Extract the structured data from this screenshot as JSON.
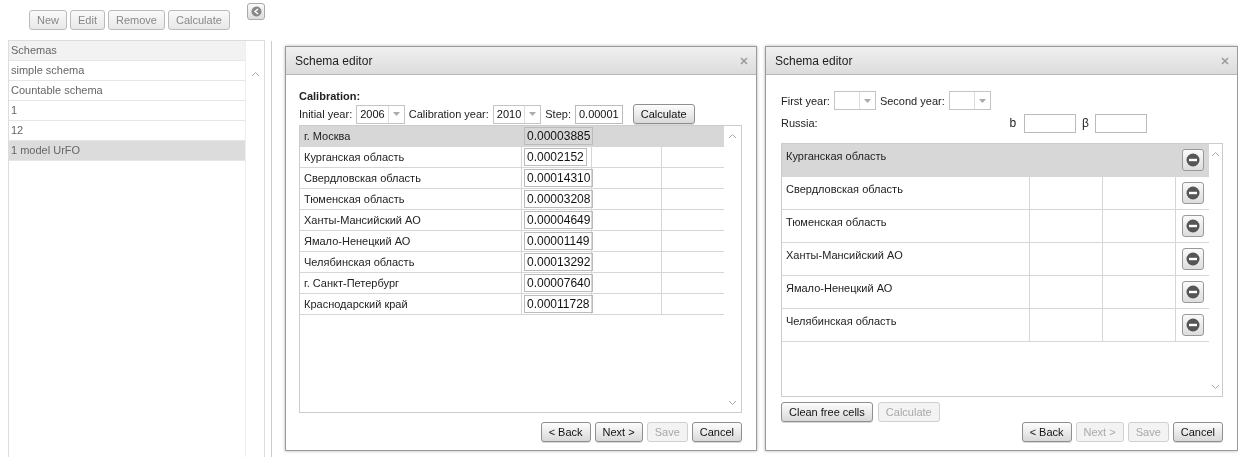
{
  "toolbar": {
    "buttons": [
      {
        "label": "New",
        "disabled": true
      },
      {
        "label": "Edit",
        "disabled": true
      },
      {
        "label": "Remove",
        "disabled": true
      },
      {
        "label": "Calculate",
        "disabled": true
      }
    ]
  },
  "schemas": {
    "header": "Schemas",
    "items": [
      {
        "label": "simple schema",
        "selected": false
      },
      {
        "label": "Countable schema",
        "selected": false
      },
      {
        "label": "1",
        "selected": false
      },
      {
        "label": "12",
        "selected": false
      },
      {
        "label": "1 model UrFO",
        "selected": true
      }
    ]
  },
  "calibration_dialog": {
    "title": "Schema editor",
    "section_title": "Calibration:",
    "initial_year": {
      "label": "Initial year:",
      "value": "2006"
    },
    "calibration_year": {
      "label": "Calibration year:",
      "value": "2010"
    },
    "step": {
      "label": "Step:",
      "value": "0.00001"
    },
    "calculate_button": "Calculate",
    "rows": [
      {
        "region": "г. Москва",
        "value": "0.00003885",
        "selected": true
      },
      {
        "region": "Курганская область",
        "value": "0.0002152",
        "selected": false
      },
      {
        "region": "Свердловская область",
        "value": "0.00014310",
        "selected": false
      },
      {
        "region": "Тюменская область",
        "value": "0.00003208",
        "selected": false
      },
      {
        "region": "Ханты-Мансийский АО",
        "value": "0.00004649",
        "selected": false
      },
      {
        "region": "Ямало-Ненецкий АО",
        "value": "0.00001149",
        "selected": false
      },
      {
        "region": "Челябинская область",
        "value": "0.00013292",
        "selected": false
      },
      {
        "region": "г. Санкт-Петербург",
        "value": "0.00007640",
        "selected": false
      },
      {
        "region": "Краснодарский край",
        "value": "0.00011728",
        "selected": false
      }
    ],
    "buttons": [
      {
        "label": "< Back",
        "disabled": false
      },
      {
        "label": "Next >",
        "disabled": false
      },
      {
        "label": "Save",
        "disabled": true
      },
      {
        "label": "Cancel",
        "disabled": false
      }
    ]
  },
  "comparison_dialog": {
    "title": "Schema editor",
    "first_year": {
      "label": "First year:"
    },
    "second_year": {
      "label": "Second year:"
    },
    "russia_label": "Russia:",
    "b_label": "b",
    "beta_label": "β",
    "rows": [
      {
        "region": "Курганская область",
        "selected": true
      },
      {
        "region": "Свердловская область",
        "selected": false
      },
      {
        "region": "Тюменская область",
        "selected": false
      },
      {
        "region": "Ханты-Мансийский АО",
        "selected": false
      },
      {
        "region": "Ямало-Ненецкий АО",
        "selected": false
      },
      {
        "region": "Челябинская область",
        "selected": false
      }
    ],
    "actions": [
      {
        "label": "Clean free cells",
        "disabled": false
      },
      {
        "label": "Calculate",
        "disabled": true
      }
    ],
    "buttons": [
      {
        "label": "< Back",
        "disabled": false
      },
      {
        "label": "Next >",
        "disabled": true
      },
      {
        "label": "Save",
        "disabled": true
      },
      {
        "label": "Cancel",
        "disabled": false
      }
    ]
  }
}
